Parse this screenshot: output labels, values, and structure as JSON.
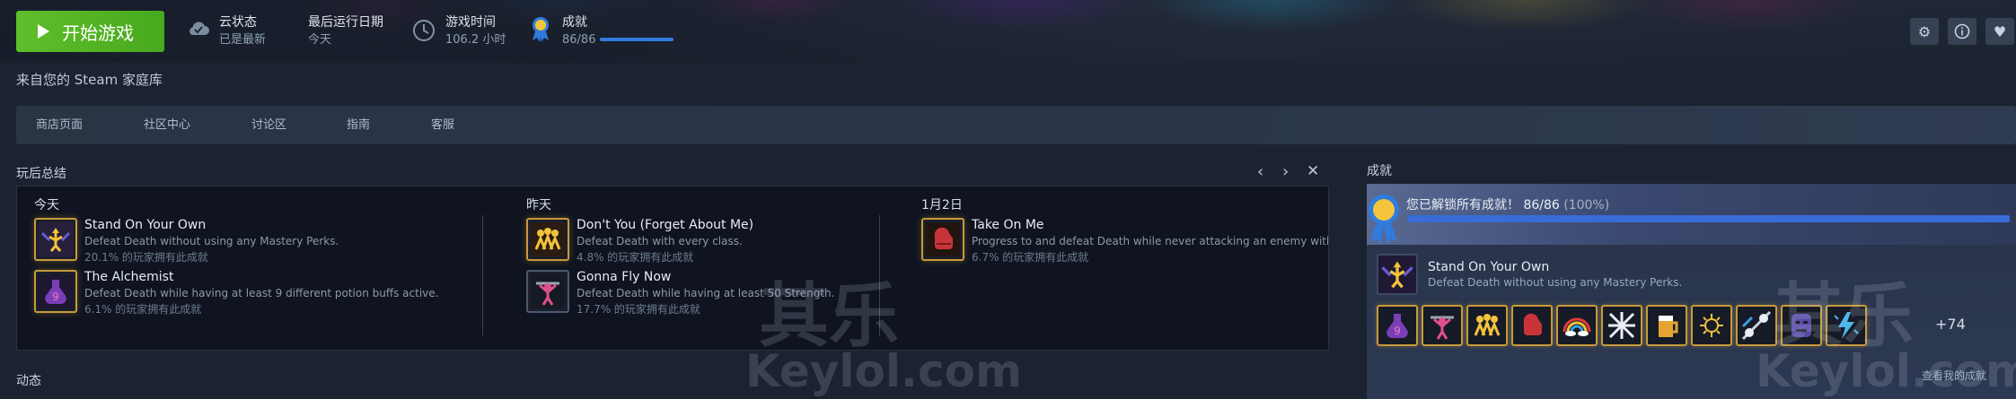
{
  "top": {
    "play_label": "开始游戏",
    "cloud_label": "云状态",
    "cloud_value": "已是最新",
    "last_run_label": "最后运行日期",
    "last_run_value": "今天",
    "playtime_label": "游戏时间",
    "playtime_value": "106.2 小时",
    "achievements_label": "成就",
    "achievements_value": "86/86",
    "achievements_progress": 1.0,
    "icons": [
      "gear-icon",
      "info-icon",
      "heart-icon"
    ]
  },
  "source_line": "来自您的 Steam 家庭库",
  "nav": [
    "商店页面",
    "社区中心",
    "讨论区",
    "指南",
    "客服"
  ],
  "recap": {
    "title": "玩后总结",
    "columns": [
      {
        "heading": "今天",
        "items": [
          {
            "title": "Stand On Your Own",
            "desc": "Defeat Death without using any Mastery Perks.",
            "pct": "20.1% 的玩家拥有此成就",
            "icon": "winged-figure-icon"
          },
          {
            "title": "The Alchemist",
            "desc": "Defeat Death while having at least 9 different potion buffs active.",
            "pct": "6.1% 的玩家拥有此成就",
            "icon": "potion-icon"
          }
        ]
      },
      {
        "heading": "昨天",
        "items": [
          {
            "title": "Don't You (Forget About Me)",
            "desc": "Defeat Death with every class.",
            "pct": "4.8% 的玩家拥有此成就",
            "icon": "group-heroes-icon"
          },
          {
            "title": "Gonna Fly Now",
            "desc": "Defeat Death while having at least 50 Strength.",
            "pct": "17.7% 的玩家拥有此成就",
            "icon": "strongman-icon"
          }
        ]
      },
      {
        "heading": "1月2日",
        "items": [
          {
            "title": "Take On Me",
            "desc": "Progress to and defeat Death while never attacking an enemy with",
            "pct": "6.7% 的玩家拥有此成就",
            "icon": "boxing-glove-icon"
          }
        ]
      }
    ]
  },
  "activity_title": "动态",
  "achievements_panel": {
    "title": "成就",
    "summary_main": "您已解锁所有成就！ 86/86",
    "summary_pct": "(100%)",
    "progress": 1.0,
    "featured_title": "Stand On Your Own",
    "featured_desc": "Defeat Death without using any Mastery Perks.",
    "icons": [
      "potion-icon",
      "strongman-icon",
      "group-heroes-icon",
      "boxing-glove-icon",
      "rainbow-icon",
      "pattern-icon",
      "beer-icon",
      "sun-glyph-icon",
      "skull-pattern-icon",
      "stone-face-icon",
      "lightning-icon"
    ],
    "more": "+74",
    "view_all": "查看我的成就"
  },
  "watermark": {
    "brand": "其乐",
    "site": "Keylol.com"
  },
  "colors": {
    "play": "#5fbe2b",
    "progress": "#2f7bde",
    "gold_border": "#c89a3a"
  }
}
